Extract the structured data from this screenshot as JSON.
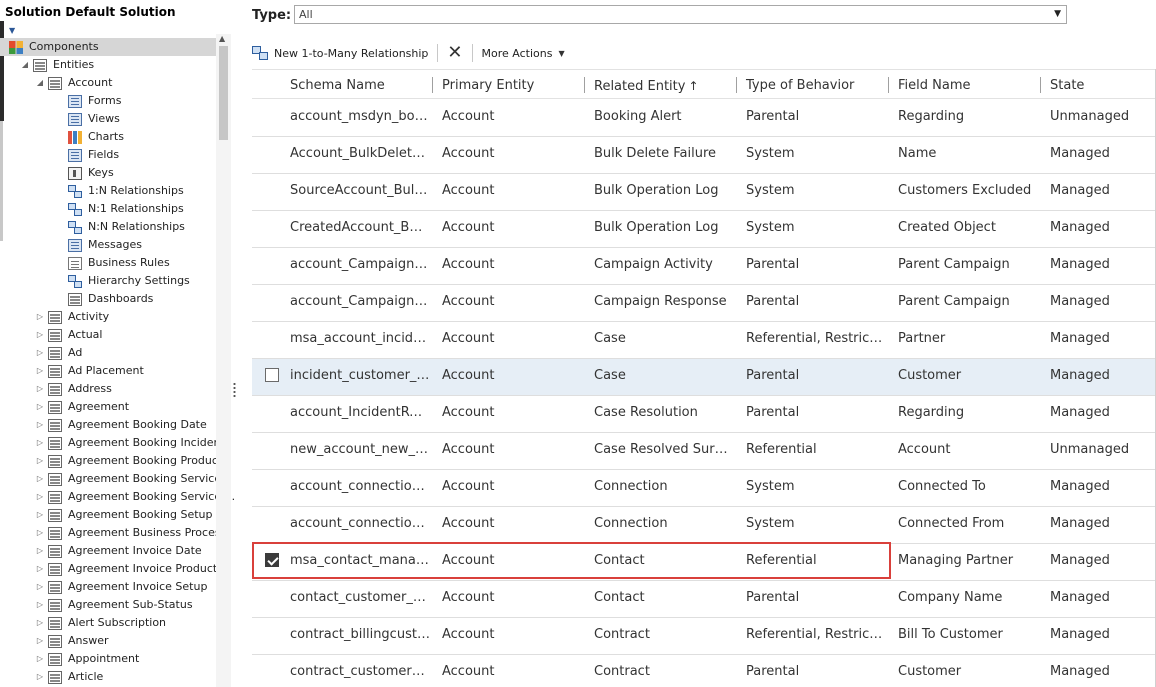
{
  "solution": {
    "title": "Solution Default Solution"
  },
  "tree": {
    "components_label": "Components",
    "entities_label": "Entities",
    "account_label": "Account",
    "account_children": [
      {
        "label": "Forms",
        "icon": "forms-icon"
      },
      {
        "label": "Views",
        "icon": "views-icon"
      },
      {
        "label": "Charts",
        "icon": "charts-icon"
      },
      {
        "label": "Fields",
        "icon": "fields-icon"
      },
      {
        "label": "Keys",
        "icon": "keys-icon"
      },
      {
        "label": "1:N Relationships",
        "icon": "one-to-many-relationship-icon"
      },
      {
        "label": "N:1 Relationships",
        "icon": "many-to-one-relationship-icon"
      },
      {
        "label": "N:N Relationships",
        "icon": "many-to-many-relationship-icon"
      },
      {
        "label": "Messages",
        "icon": "messages-icon"
      },
      {
        "label": "Business Rules",
        "icon": "business-rules-icon"
      },
      {
        "label": "Hierarchy Settings",
        "icon": "hierarchy-settings-icon"
      },
      {
        "label": "Dashboards",
        "icon": "dashboards-icon"
      }
    ],
    "entities": [
      "Activity",
      "Actual",
      "Ad",
      "Ad Placement",
      "Address",
      "Agreement",
      "Agreement Booking Date",
      "Agreement Booking Incident",
      "Agreement Booking Product",
      "Agreement Booking Service",
      "Agreement Booking Service ...",
      "Agreement Booking Setup",
      "Agreement Business Process",
      "Agreement Invoice Date",
      "Agreement Invoice Product",
      "Agreement Invoice Setup",
      "Agreement Sub-Status",
      "Alert Subscription",
      "Answer",
      "Appointment",
      "Article"
    ]
  },
  "filter": {
    "type_label": "Type:",
    "type_value": "All"
  },
  "toolbar": {
    "new_relationship_label": "New 1-to-Many Relationship",
    "more_actions_label": "More Actions"
  },
  "grid": {
    "columns": [
      "Schema Name",
      "Primary Entity",
      "Related Entity",
      "Type of Behavior",
      "Field Name",
      "State"
    ],
    "sort_indicator": "↑",
    "rows": [
      {
        "schema": "account_msdyn_booki...",
        "primary": "Account",
        "related": "Booking Alert",
        "behavior": "Parental",
        "field": "Regarding",
        "state": "Unmanaged"
      },
      {
        "schema": "Account_BulkDeleteFa...",
        "primary": "Account",
        "related": "Bulk Delete Failure",
        "behavior": "System",
        "field": "Name",
        "state": "Managed"
      },
      {
        "schema": "SourceAccount_BulkO...",
        "primary": "Account",
        "related": "Bulk Operation Log",
        "behavior": "System",
        "field": "Customers Excluded",
        "state": "Managed"
      },
      {
        "schema": "CreatedAccount_Bulk...",
        "primary": "Account",
        "related": "Bulk Operation Log",
        "behavior": "System",
        "field": "Created Object",
        "state": "Managed"
      },
      {
        "schema": "account_CampaignAct...",
        "primary": "Account",
        "related": "Campaign Activity",
        "behavior": "Parental",
        "field": "Parent Campaign",
        "state": "Managed"
      },
      {
        "schema": "account_CampaignRes...",
        "primary": "Account",
        "related": "Campaign Response",
        "behavior": "Parental",
        "field": "Parent Campaign",
        "state": "Managed"
      },
      {
        "schema": "msa_account_incident",
        "primary": "Account",
        "related": "Case",
        "behavior": "Referential, Restrict D...",
        "field": "Partner",
        "state": "Managed"
      },
      {
        "schema": "incident_customer_acc...",
        "primary": "Account",
        "related": "Case",
        "behavior": "Parental",
        "field": "Customer",
        "state": "Managed"
      },
      {
        "schema": "account_IncidentResol...",
        "primary": "Account",
        "related": "Case Resolution",
        "behavior": "Parental",
        "field": "Regarding",
        "state": "Managed"
      },
      {
        "schema": "new_account_new_cas...",
        "primary": "Account",
        "related": "Case Resolved Survey",
        "behavior": "Referential",
        "field": "Account",
        "state": "Unmanaged"
      },
      {
        "schema": "account_connections2",
        "primary": "Account",
        "related": "Connection",
        "behavior": "System",
        "field": "Connected To",
        "state": "Managed"
      },
      {
        "schema": "account_connections1",
        "primary": "Account",
        "related": "Connection",
        "behavior": "System",
        "field": "Connected From",
        "state": "Managed"
      },
      {
        "schema": "msa_contact_managin...",
        "primary": "Account",
        "related": "Contact",
        "behavior": "Referential",
        "field": "Managing Partner",
        "state": "Managed"
      },
      {
        "schema": "contact_customer_acc...",
        "primary": "Account",
        "related": "Contact",
        "behavior": "Parental",
        "field": "Company Name",
        "state": "Managed"
      },
      {
        "schema": "contract_billingcusto...",
        "primary": "Account",
        "related": "Contract",
        "behavior": "Referential, Restrict D...",
        "field": "Bill To Customer",
        "state": "Managed"
      },
      {
        "schema": "contract_customer_ac...",
        "primary": "Account",
        "related": "Contract",
        "behavior": "Parental",
        "field": "Customer",
        "state": "Managed"
      }
    ]
  }
}
